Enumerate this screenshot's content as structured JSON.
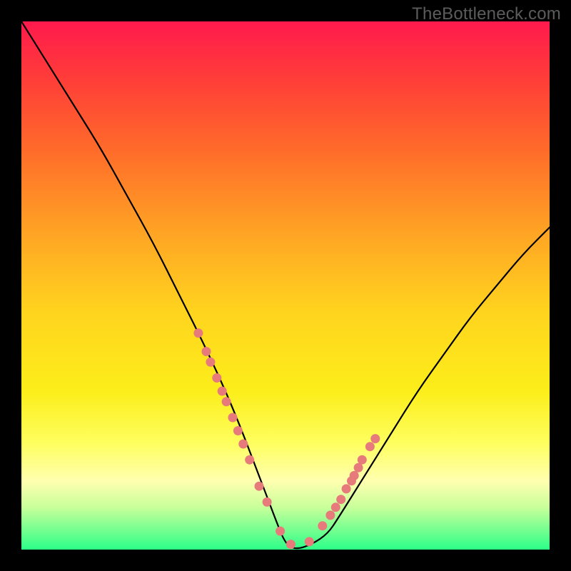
{
  "watermark": "TheBottleneck.com",
  "chart_data": {
    "type": "line",
    "title": "",
    "xlabel": "",
    "ylabel": "",
    "xlim": [
      0,
      100
    ],
    "ylim": [
      0,
      100
    ],
    "series": [
      {
        "name": "bottleneck-curve",
        "x": [
          0,
          5,
          10,
          15,
          20,
          25,
          30,
          35,
          40,
          45,
          48,
          50,
          52,
          55,
          58,
          60,
          65,
          70,
          75,
          80,
          85,
          90,
          95,
          100
        ],
        "y": [
          100,
          92,
          84,
          76,
          67,
          58,
          48,
          38,
          27,
          14,
          6,
          1,
          0,
          1,
          3,
          6,
          14,
          22,
          30,
          37,
          44,
          50,
          56,
          61
        ]
      }
    ],
    "markers": {
      "name": "highlight-dots",
      "color": "#e77a7a",
      "x": [
        33.5,
        35.0,
        35.8,
        37.0,
        38.0,
        38.8,
        40.0,
        41.0,
        42.0,
        43.2,
        45.0,
        46.5,
        49.0,
        51.0,
        54.5,
        57.0,
        58.5,
        59.5,
        60.5,
        61.5,
        62.5,
        63.0,
        63.8,
        64.5,
        66.0,
        67.0
      ],
      "y": [
        41.0,
        37.5,
        35.5,
        32.5,
        30.0,
        28.0,
        25.0,
        22.5,
        20.0,
        17.0,
        12.0,
        9.0,
        3.5,
        1.0,
        1.5,
        4.5,
        6.5,
        8.0,
        9.5,
        11.5,
        13.0,
        14.0,
        15.5,
        17.0,
        19.5,
        21.0
      ]
    }
  }
}
